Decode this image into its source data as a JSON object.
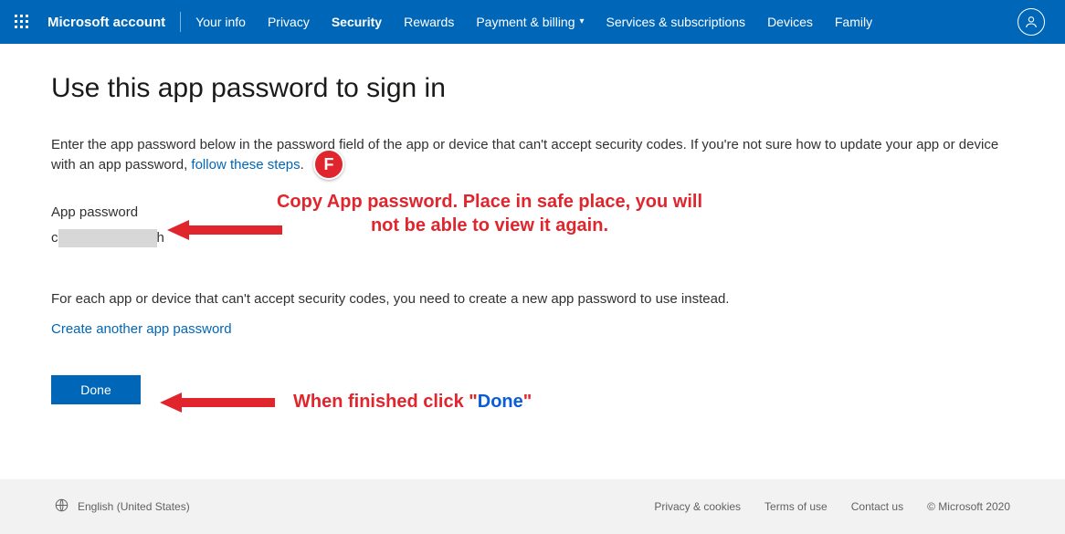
{
  "header": {
    "brand": "Microsoft account",
    "nav": {
      "your_info": "Your info",
      "privacy": "Privacy",
      "security": "Security",
      "rewards": "Rewards",
      "payment": "Payment & billing",
      "services": "Services & subscriptions",
      "devices": "Devices",
      "family": "Family"
    }
  },
  "page": {
    "title": "Use this app password to sign in",
    "intro_a": "Enter the app password below in the password field of the app or device that can't accept security codes. If you're not sure how to update your app or device with an app password, ",
    "intro_link": "follow these steps",
    "intro_dot": ".",
    "label": "App password",
    "pwd_prefix": "c",
    "pwd_suffix": "h",
    "per_app": "For each app or device that can't accept security codes, you need to create a new app password to use instead.",
    "create_link": "Create another app password",
    "done": "Done"
  },
  "annotations": {
    "badge": "F",
    "copy_line1": "Copy App password. Place in safe place, you will",
    "copy_line2": "not be able to view it again.",
    "done_prefix": "When finished click \"",
    "done_word": "Done",
    "done_suffix": "\""
  },
  "footer": {
    "lang": "English (United States)",
    "privacy": "Privacy & cookies",
    "terms": "Terms of use",
    "contact": "Contact us",
    "copyright": "© Microsoft 2020"
  }
}
